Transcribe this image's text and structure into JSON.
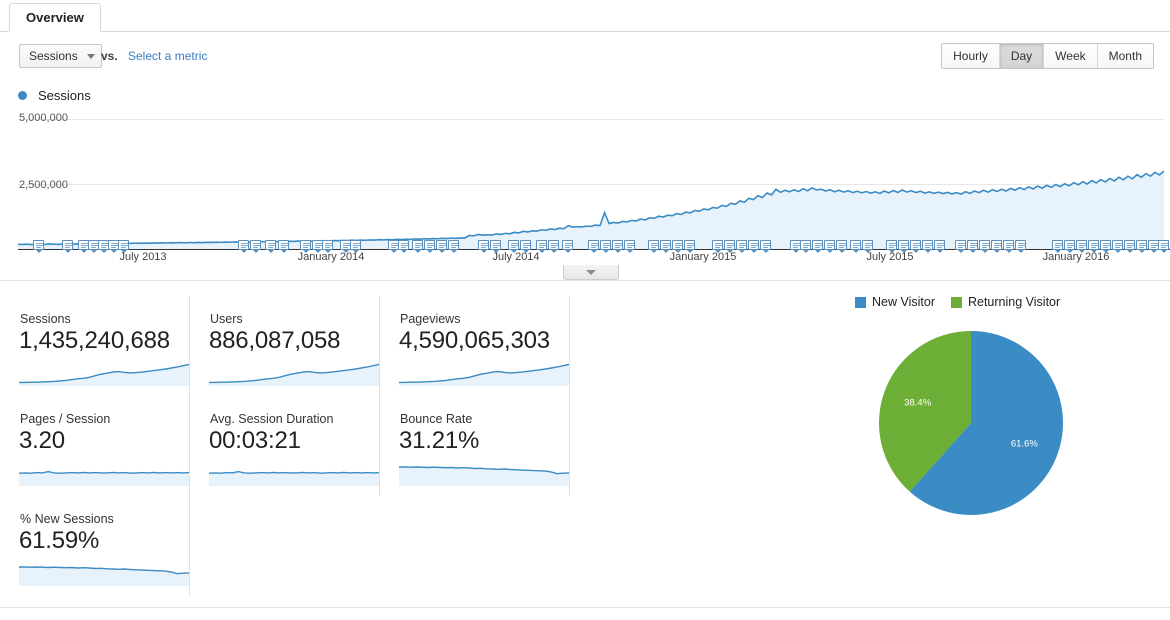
{
  "tab": {
    "label": "Overview"
  },
  "controls": {
    "metric_select": {
      "value": "Sessions",
      "caret_icon": "chevron-down-icon"
    },
    "vs_label": "vs.",
    "compare_link": "Select a metric",
    "granularity": {
      "options": [
        "Hourly",
        "Day",
        "Week",
        "Month"
      ],
      "selected": "Day"
    }
  },
  "chart_legend": {
    "series_name": "Sessions",
    "color": "#3b8bc4"
  },
  "collapse_handle": {
    "icon": "chevron-down-icon"
  },
  "chart_data": {
    "type": "area",
    "title": "Sessions",
    "xlabel": "",
    "ylabel": "Sessions",
    "ylim": [
      0,
      5000000
    ],
    "ytick_labels": [
      "5,000,000",
      "2,500,000"
    ],
    "ytick_values": [
      5000000,
      2500000
    ],
    "grid": true,
    "legend_position": "top-left",
    "xtick_labels": [
      "July 2013",
      "January 2014",
      "July 2014",
      "January 2015",
      "July 2015",
      "January 2016"
    ],
    "line_color": "#3b8bc4",
    "fill_color": "#e8f2fa",
    "series": [
      {
        "name": "Sessions",
        "values": [
          180000,
          176000,
          185000,
          172000,
          190000,
          183000,
          178000,
          195000,
          186000,
          181000,
          192000,
          188000,
          197000,
          190000,
          203000,
          196000,
          205000,
          199000,
          210000,
          204000,
          213000,
          207000,
          218000,
          211000,
          222000,
          216000,
          226000,
          219000,
          230000,
          224000,
          234000,
          227000,
          238000,
          231000,
          242000,
          236000,
          246000,
          239000,
          250000,
          243000,
          254000,
          248000,
          258000,
          251000,
          262000,
          255000,
          266000,
          260000,
          270000,
          263000,
          275000,
          268000,
          280000,
          273000,
          284000,
          278000,
          289000,
          282000,
          294000,
          287000,
          299000,
          292000,
          304000,
          297000,
          309000,
          302000,
          315000,
          308000,
          320000,
          313000,
          326000,
          318000,
          332000,
          324000,
          338000,
          330000,
          344000,
          336000,
          350000,
          342000,
          357000,
          349000,
          364000,
          356000,
          371000,
          363000,
          378000,
          370000,
          386000,
          378000,
          394000,
          386000,
          402000,
          394000,
          410000,
          402000,
          418000,
          410000,
          427000,
          419000,
          520000,
          505000,
          560000,
          530000,
          545000,
          535000,
          580000,
          560000,
          600000,
          585000,
          640000,
          620000,
          680000,
          655000,
          700000,
          685000,
          740000,
          720000,
          770000,
          750000,
          800000,
          780000,
          900000,
          840000,
          860000,
          850000,
          880000,
          870000,
          920000,
          900000,
          1400000,
          980000,
          1020000,
          1000000,
          1060000,
          1040000,
          1100000,
          1080000,
          1150000,
          1120000,
          1200000,
          1180000,
          1260000,
          1230000,
          1300000,
          1280000,
          1360000,
          1330000,
          1420000,
          1390000,
          1480000,
          1450000,
          1540000,
          1510000,
          1600000,
          1570000,
          1680000,
          1640000,
          1760000,
          1720000,
          1850000,
          1800000,
          1950000,
          1900000,
          2050000,
          1980000,
          2150000,
          2080000,
          2300000,
          2180000,
          2260000,
          2200000,
          2280000,
          2210000,
          2320000,
          2240000,
          2350000,
          2270000,
          2300000,
          2230000,
          2280000,
          2200000,
          2260000,
          2190000,
          2240000,
          2170000,
          2220000,
          2160000,
          2210000,
          2150000,
          2200000,
          2140000,
          2230000,
          2160000,
          2250000,
          2180000,
          2270000,
          2190000,
          2240000,
          2170000,
          2220000,
          2150000,
          2200000,
          2140000,
          2190000,
          2130000,
          2180000,
          2120000,
          2170000,
          2110000,
          2200000,
          2140000,
          2230000,
          2170000,
          2260000,
          2190000,
          2280000,
          2210000,
          2300000,
          2230000,
          2330000,
          2260000,
          2360000,
          2290000,
          2390000,
          2310000,
          2420000,
          2340000,
          2450000,
          2370000,
          2480000,
          2400000,
          2510000,
          2430000,
          2550000,
          2470000,
          2590000,
          2500000,
          2630000,
          2540000,
          2670000,
          2580000,
          2710000,
          2620000,
          2760000,
          2660000,
          2800000,
          2700000,
          2860000,
          2760000,
          2900000,
          2800000,
          2950000,
          2850000,
          3000000
        ]
      }
    ]
  },
  "metric_cards": [
    {
      "title": "Sessions",
      "value": "1,435,240,688",
      "trend": "rising"
    },
    {
      "title": "Users",
      "value": "886,087,058",
      "trend": "rising"
    },
    {
      "title": "Pageviews",
      "value": "4,590,065,303",
      "trend": "rising"
    },
    {
      "title": "Pages / Session",
      "value": "3.20",
      "trend": "flat"
    },
    {
      "title": "Avg. Session Duration",
      "value": "00:03:21",
      "trend": "flat"
    },
    {
      "title": "Bounce Rate",
      "value": "31.21%",
      "trend": "declining"
    },
    {
      "title": "% New Sessions",
      "value": "61.59%",
      "trend": "declining"
    }
  ],
  "pie_chart": {
    "type": "pie",
    "title": "",
    "legend_position": "top",
    "categories": [
      "New Visitor",
      "Returning Visitor"
    ],
    "values": [
      61.6,
      38.4
    ],
    "value_labels": [
      "61.6%",
      "38.4%"
    ],
    "colors": [
      "#3b8bc4",
      "#6cae36"
    ]
  }
}
